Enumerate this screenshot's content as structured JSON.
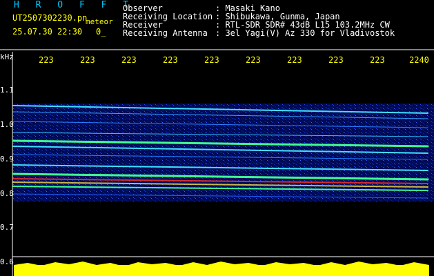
{
  "header": {
    "logo": "H R O F F T",
    "filename": "UT2507302230.pn",
    "meteor_label": "meteor",
    "datetime": "25.07.30 22:30",
    "sub_value": "0_",
    "info_labels": [
      "Observer",
      "Receiving Location",
      "Receiver",
      "Receiving Antenna"
    ],
    "info_values": [
      ": Masaki Kano",
      ": Shibukawa, Gunma, Japan",
      ": RTL-SDR SDR# 43dB L15 103.2MHz CW",
      ": 3el Yagi(V) Az 330 for Vladivostok"
    ]
  },
  "axes": {
    "freq_unit": "kHz",
    "time_ticks": [
      "223",
      "223",
      "223",
      "223",
      "223",
      "223",
      "223",
      "223",
      "223",
      "2240"
    ],
    "freq_ticks": [
      "1.1",
      "1.0",
      "0.9",
      "0.8",
      "0.7",
      "0.6"
    ]
  },
  "colors": {
    "background": "#000000",
    "header_text": "#ffffff",
    "highlight": "#ffff00",
    "logo": "#00c8ff",
    "noise_floor": "#000a5a",
    "signal_line": "#40e0ff",
    "hot_signal": "#ff3020",
    "amplitude_bar": "#ffff00"
  }
}
